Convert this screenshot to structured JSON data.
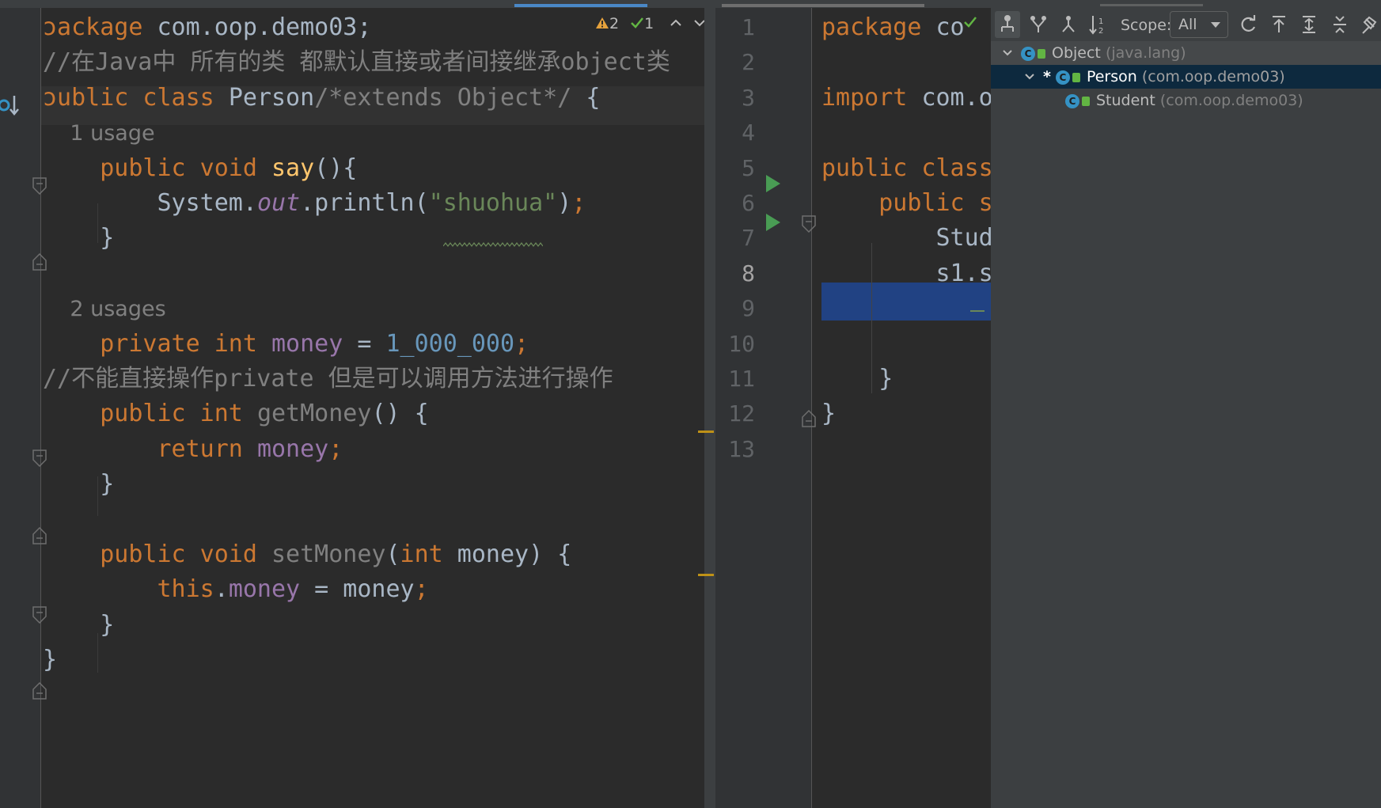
{
  "left_editor": {
    "inspection": {
      "warnings": "2",
      "weak_warnings": "1"
    },
    "lines": [
      {
        "tokens": [
          {
            "t": "ɔackage",
            "c": "kw"
          },
          {
            "t": " com.oop.demo03;",
            "c": ""
          }
        ]
      },
      {
        "tokens": [
          {
            "t": "//在Java中 所有的类 都默认直接或者间接继承object类",
            "c": "cm"
          }
        ]
      },
      {
        "tokens": [
          {
            "t": "ɔublic class ",
            "c": "kw"
          },
          {
            "t": "Person",
            "c": ""
          },
          {
            "t": "/*extends Object*/",
            "c": "cm"
          },
          {
            "t": " {",
            "c": ""
          }
        ]
      },
      {
        "tokens": [
          {
            "t": "    1 usage",
            "c": "hint"
          }
        ]
      },
      {
        "tokens": [
          {
            "t": "    public void ",
            "c": "kw"
          },
          {
            "t": "say",
            "c": "fn"
          },
          {
            "t": "(){",
            "c": ""
          }
        ]
      },
      {
        "tokens": [
          {
            "t": "        System.",
            "c": ""
          },
          {
            "t": "out",
            "c": "fld it"
          },
          {
            "t": ".println(",
            "c": ""
          },
          {
            "t": "\"shuohua\"",
            "c": "str"
          },
          {
            "t": ")",
            "c": ""
          },
          {
            "t": ";",
            "c": "kw"
          }
        ]
      },
      {
        "tokens": [
          {
            "t": "    }",
            "c": ""
          }
        ]
      },
      {
        "tokens": []
      },
      {
        "tokens": [
          {
            "t": "    2 usages",
            "c": "hint"
          }
        ]
      },
      {
        "tokens": [
          {
            "t": "    private int ",
            "c": "kw"
          },
          {
            "t": "money",
            "c": "fld"
          },
          {
            "t": " = ",
            "c": ""
          },
          {
            "t": "1_000_000",
            "c": "num"
          },
          {
            "t": ";",
            "c": "kw"
          }
        ]
      },
      {
        "tokens": [
          {
            "t": "//不能直接操作private 但是可以调用方法进行操作",
            "c": "cm"
          }
        ]
      },
      {
        "tokens": [
          {
            "t": "    public int ",
            "c": "kw"
          },
          {
            "t": "getMoney",
            "c": "muted"
          },
          {
            "t": "() {",
            "c": ""
          }
        ]
      },
      {
        "tokens": [
          {
            "t": "        return ",
            "c": "kw"
          },
          {
            "t": "money",
            "c": "fld"
          },
          {
            "t": ";",
            "c": "kw"
          }
        ]
      },
      {
        "tokens": [
          {
            "t": "    }",
            "c": ""
          }
        ]
      },
      {
        "tokens": []
      },
      {
        "tokens": [
          {
            "t": "    public void ",
            "c": "kw"
          },
          {
            "t": "setMoney",
            "c": "muted"
          },
          {
            "t": "(",
            "c": ""
          },
          {
            "t": "int ",
            "c": "kw"
          },
          {
            "t": "money) {",
            "c": ""
          }
        ]
      },
      {
        "tokens": [
          {
            "t": "        this",
            "c": "kw"
          },
          {
            "t": ".",
            "c": ""
          },
          {
            "t": "money",
            "c": "fld"
          },
          {
            "t": " = money",
            "c": ""
          },
          {
            "t": ";",
            "c": "kw"
          }
        ]
      },
      {
        "tokens": [
          {
            "t": "    }",
            "c": ""
          }
        ]
      },
      {
        "tokens": [
          {
            "t": "}",
            "c": ""
          }
        ]
      }
    ]
  },
  "right_editor": {
    "line_numbers": [
      "1",
      "2",
      "3",
      "4",
      "5",
      "6",
      "7",
      "8",
      "9",
      "10",
      "11",
      "12",
      "13"
    ],
    "lines": [
      {
        "tokens": [
          {
            "t": "package ",
            "c": "kw"
          },
          {
            "t": "co",
            "c": ""
          }
        ]
      },
      {
        "tokens": []
      },
      {
        "tokens": [
          {
            "t": "import ",
            "c": "kw"
          },
          {
            "t": "com.o",
            "c": ""
          }
        ]
      },
      {
        "tokens": []
      },
      {
        "tokens": [
          {
            "t": "public class",
            "c": "kw"
          }
        ]
      },
      {
        "tokens": [
          {
            "t": "    public s",
            "c": "kw"
          }
        ]
      },
      {
        "tokens": [
          {
            "t": "        Stud",
            "c": ""
          }
        ]
      },
      {
        "tokens": [
          {
            "t": "        s1.s",
            "c": ""
          }
        ]
      },
      {
        "tokens": []
      },
      {
        "tokens": []
      },
      {
        "tokens": [
          {
            "t": "    }",
            "c": ""
          }
        ]
      },
      {
        "tokens": [
          {
            "t": "}",
            "c": ""
          }
        ]
      },
      {
        "tokens": []
      }
    ]
  },
  "hierarchy": {
    "scope_label": "Scope:",
    "scope_value": "All",
    "nodes": [
      {
        "name": "Object",
        "package": "(java.lang)",
        "selected": false
      },
      {
        "name": "Person",
        "package": "(com.oop.demo03)",
        "selected": true,
        "marker": "*"
      },
      {
        "name": "Student",
        "package": "(com.oop.demo03)",
        "selected": false
      }
    ]
  },
  "colors": {
    "keyword": "#cc7832",
    "comment": "#808080",
    "string": "#6a8759",
    "number": "#6897bb",
    "field": "#9876aa",
    "function": "#ffc66d",
    "selection": "#214283",
    "selected_tree_row": "#0d293e"
  },
  "icons": [
    "warning-icon",
    "check-icon",
    "chevron-up-icon",
    "chevron-down-icon",
    "run-icon",
    "fold-icon",
    "class-icon",
    "lock-icon",
    "subtypes-icon",
    "supertypes-icon",
    "hierarchy-icon",
    "sort-icon",
    "refresh-icon",
    "export-icon",
    "expand-icon",
    "collapse-icon",
    "pin-icon",
    "override-icon"
  ]
}
